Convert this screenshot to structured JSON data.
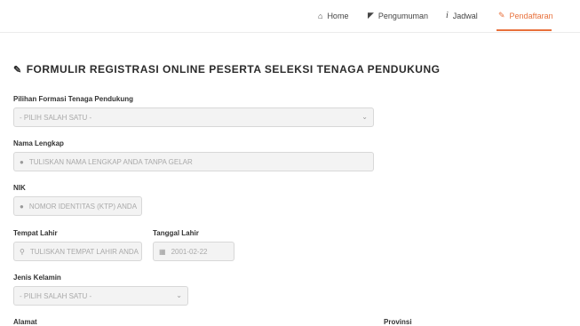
{
  "nav": {
    "items": [
      {
        "label": "Home",
        "icon": "home-icon",
        "glyph": "⌂"
      },
      {
        "label": "Pengumuman",
        "icon": "megaphone-icon",
        "glyph": "◤"
      },
      {
        "label": "Jadwal",
        "icon": "info-icon",
        "glyph": "i"
      },
      {
        "label": "Pendaftaran",
        "icon": "pencil-icon",
        "glyph": "✎"
      }
    ],
    "active_color": "#e8713c"
  },
  "form": {
    "title": "FORMULIR REGISTRASI ONLINE PESERTA SELEKSI TENAGA PENDUKUNG",
    "title_icon": "pencil-icon",
    "formasi": {
      "label": "Pilihan Formasi Tenaga Pendukung",
      "value": "- PILIH SALAH SATU -"
    },
    "nama": {
      "label": "Nama Lengkap",
      "placeholder": "TULISKAN NAMA LENGKAP ANDA TANPA GELAR",
      "icon": "user-icon"
    },
    "nik": {
      "label": "NIK",
      "placeholder": "NOMOR IDENTITAS (KTP) ANDA",
      "icon": "user-icon"
    },
    "tempat_lahir": {
      "label": "Tempat Lahir",
      "placeholder": "TULISKAN TEMPAT LAHIR ANDA",
      "icon": "map-marker-icon"
    },
    "tanggal_lahir": {
      "label": "Tanggal Lahir",
      "placeholder": "2001-02-22",
      "icon": "calendar-icon"
    },
    "jenis_kelamin": {
      "label": "Jenis Kelamin",
      "value": "- PILIH SALAH SATU -"
    },
    "alamat": {
      "label": "Alamat"
    },
    "provinsi": {
      "label": "Provinsi"
    }
  }
}
